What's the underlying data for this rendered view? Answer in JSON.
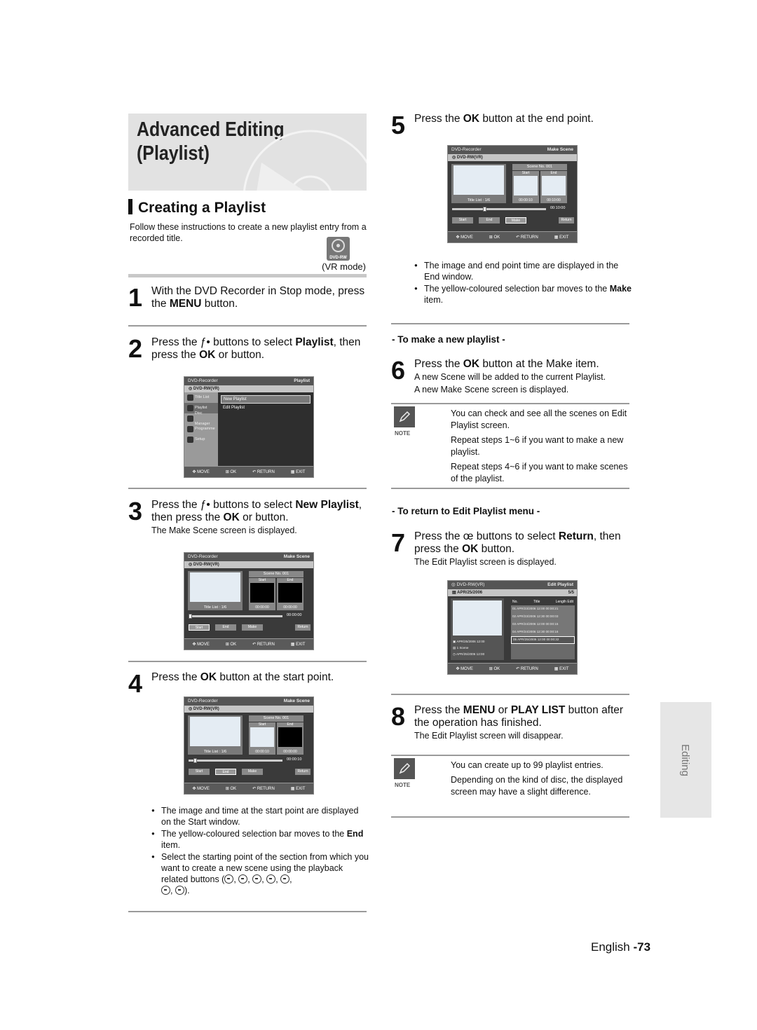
{
  "header": {
    "title_line1": "Advanced Editing",
    "title_line2": "(Playlist)"
  },
  "section": {
    "title": "Creating a Playlist",
    "intro": "Follow these instructions to create a new playlist entry from a recorded title.",
    "disc_badge": "DVD-RW",
    "mode": "(VR mode)"
  },
  "steps": [
    {
      "num": "1",
      "parts": [
        "With the DVD Recorder in Stop mode, press the ",
        "MENU",
        " button."
      ]
    },
    {
      "num": "2",
      "parts": [
        "Press the ƒ•   buttons to select ",
        "Playlist",
        ", then press the ",
        "OK",
        " or     button."
      ]
    },
    {
      "num": "3",
      "parts": [
        "Press the ƒ•   buttons to select ",
        "New Playlist",
        ", then press the ",
        "OK",
        " or     button."
      ],
      "sub": "The Make Scene screen is displayed."
    },
    {
      "num": "4",
      "parts": [
        "Press the ",
        "OK",
        " button at the start point."
      ]
    },
    {
      "num": "5",
      "parts": [
        "Press the ",
        "OK",
        " button at the end point."
      ]
    },
    {
      "num": "6",
      "parts": [
        "Press the ",
        "OK",
        " button at the Make item."
      ],
      "sub": "A new Scene will be added to the current Playlist.",
      "sub2": "A new Make Scene screen is displayed."
    },
    {
      "num": "7",
      "parts": [
        "Press the œ      buttons to select ",
        "Return",
        ", then press the ",
        "OK",
        " button."
      ],
      "sub": "The Edit Playlist screen is displayed."
    },
    {
      "num": "8",
      "parts": [
        "Press the ",
        "MENU",
        " or ",
        "PLAY LIST",
        " button after the operation has finished."
      ],
      "sub": "The Edit Playlist screen will disappear."
    }
  ],
  "step4_bullets": {
    "b1": "The image and time at the start point are displayed on the Start window.",
    "b2_pre": "The yellow-coloured selection bar moves to the ",
    "b2_bold": "End",
    "b2_post": " item.",
    "b3": "Select the starting point of the section from which you want to create a new scene using the playback related buttons ("
  },
  "step5_bullets": {
    "b1": "The image and end point time are displayed in the End window.",
    "b2_pre": "The yellow-coloured selection bar moves to the ",
    "b2_bold": "Make",
    "b2_post": " item."
  },
  "subheads": {
    "new_playlist": "- To make a new playlist -",
    "return_menu": "- To return to Edit Playlist menu -"
  },
  "note1": {
    "label": "NOTE",
    "items": [
      "You can check and see all the scenes on Edit Playlist screen.",
      "Repeat steps 1~6 if you want to make a new playlist.",
      "Repeat steps 4~6 if you want to make scenes of the playlist."
    ]
  },
  "note2": {
    "label": "NOTE",
    "items": [
      "You can create up to 99 playlist entries.",
      "Depending on the kind of disc, the displayed screen may have a slight difference."
    ]
  },
  "osd_common": {
    "brand": "DVD-Recorder",
    "disc": "DVD-RW(VR)",
    "footer": [
      "MOVE",
      "OK",
      "RETURN",
      "EXIT"
    ]
  },
  "osd_menu": {
    "title": "Playlist",
    "side": [
      "Title List",
      "Playlist",
      "Disc Manager",
      "Programme",
      "Setup"
    ],
    "items": [
      "New Playlist",
      "Edit Playlist"
    ]
  },
  "osd_scene": {
    "title": "Make Scene",
    "scene_no": "Scene No. 001",
    "start_label": "Start",
    "end_label": "End",
    "caption": "Title List : 1/6",
    "buttons": [
      "Start",
      "End",
      "Make",
      "Return"
    ],
    "screens": [
      {
        "start_time": "00:00:00",
        "end_time": "00:00:00",
        "track_time": "00:00:00",
        "selected": "Start"
      },
      {
        "start_time": "00:00:10",
        "end_time": "00:00:00",
        "track_time": "00:00:10",
        "selected": "End"
      },
      {
        "start_time": "00:00:10",
        "end_time": "00:10:00",
        "track_time": "00:10:00",
        "selected": "Make"
      }
    ]
  },
  "osd_edit": {
    "disc": "DVD-RW(VR)",
    "title": "Edit Playlist",
    "date": "APR/25/2006",
    "count": "5/5",
    "cols": [
      "No.",
      "Title",
      "Length",
      "Edit"
    ],
    "rows": [
      "01 APR/23/2006  12:00  00:00:21",
      "02 APR/23/2006  12:30  00:00:03",
      "03 APR/24/2006  12:00  00:00:15",
      "04 APR/24/2006  12:30  00:00:16",
      "05 APR/25/2006  12:00  00:00:32"
    ],
    "info": [
      "APR/25/2006 12:00",
      "1 Scene",
      "APR/25/2006 12:00"
    ]
  },
  "side_tab": "Editing",
  "page": {
    "lang": "English",
    "num": "-73"
  }
}
